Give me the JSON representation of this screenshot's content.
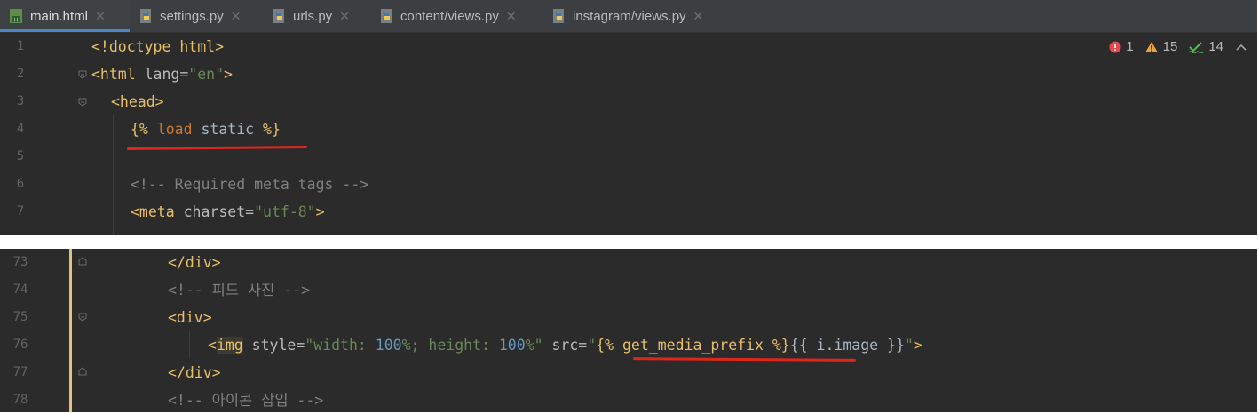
{
  "tabs": [
    {
      "label": "main.html",
      "active": true,
      "icon": "html-file-icon"
    },
    {
      "label": "settings.py",
      "active": false,
      "icon": "python-file-icon"
    },
    {
      "label": "urls.py",
      "active": false,
      "icon": "python-file-icon"
    },
    {
      "label": "content/views.py",
      "active": false,
      "icon": "python-file-icon"
    },
    {
      "label": "instagram/views.py",
      "active": false,
      "icon": "python-file-icon"
    }
  ],
  "inspections": {
    "errors": "1",
    "warnings": "15",
    "typos": "14"
  },
  "top": {
    "lines": [
      {
        "num": "1",
        "text": "<!doctype html>"
      },
      {
        "num": "2",
        "text": "<html lang=\"en\">"
      },
      {
        "num": "3",
        "text": "<head>"
      },
      {
        "num": "4",
        "text": "{% load static %}"
      },
      {
        "num": "5",
        "text": ""
      },
      {
        "num": "6",
        "text": "<!-- Required meta tags -->"
      },
      {
        "num": "7",
        "text": "<meta charset=\"utf-8\">"
      }
    ]
  },
  "bottom": {
    "lines": [
      {
        "num": "73",
        "text": "</div>"
      },
      {
        "num": "74",
        "text": "<!-- 피드 사진 -->"
      },
      {
        "num": "75",
        "text": "<div>"
      },
      {
        "num": "76",
        "text": "<img style=\"width: 100%; height: 100%\" src=\"{% get_media_prefix %}{{ i.image }}\">"
      },
      {
        "num": "77",
        "text": "</div>"
      },
      {
        "num": "78",
        "text": "<!-- 아이콘 삽입 -->"
      }
    ]
  },
  "colors": {
    "editor_bg": "#2b2b2b",
    "tab_bg": "#3c3f41",
    "accent": "#4a88c7",
    "highlight_underline": "#e0261b",
    "tag": "#e8bf6a",
    "string": "#6a8759",
    "comment": "#808080"
  }
}
